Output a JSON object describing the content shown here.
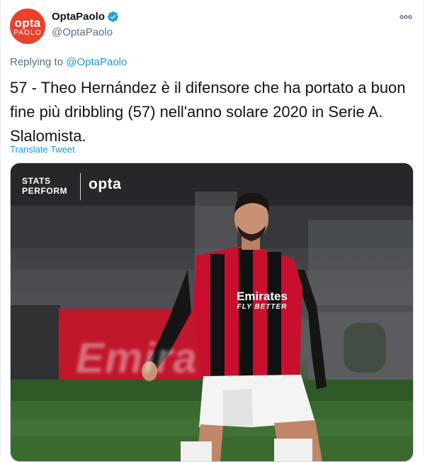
{
  "tweet": {
    "display_name": "OptaPaolo",
    "handle": "@OptaPaolo",
    "avatar": {
      "line1": "opta",
      "line2": "PAOLO",
      "color": "#e8412c"
    },
    "verified": true,
    "reply": {
      "prefix": "Replying to ",
      "mention": "@OptaPaolo"
    },
    "text": "57 - Theo Hernández è il difensore che ha portato a buon fine più dribbling (57) nell'anno solare 2020 in Serie A. Slalomista.",
    "translate_label": "Translate Tweet",
    "more_icon": "more-horizontal-icon"
  },
  "media": {
    "logo_stats_line1": "STATS",
    "logo_stats_line2": "PERFORM",
    "logo_opta": "opta",
    "shirt_sponsor_line1": "Emirates",
    "shirt_sponsor_line2": "FLY BETTER",
    "background_banner": "Emira"
  },
  "colors": {
    "link": "#1b95e0",
    "secondary_text": "#5b7083",
    "verified_badge": "#1da1f2",
    "kit_red": "#c8102e",
    "kit_black": "#111111"
  }
}
